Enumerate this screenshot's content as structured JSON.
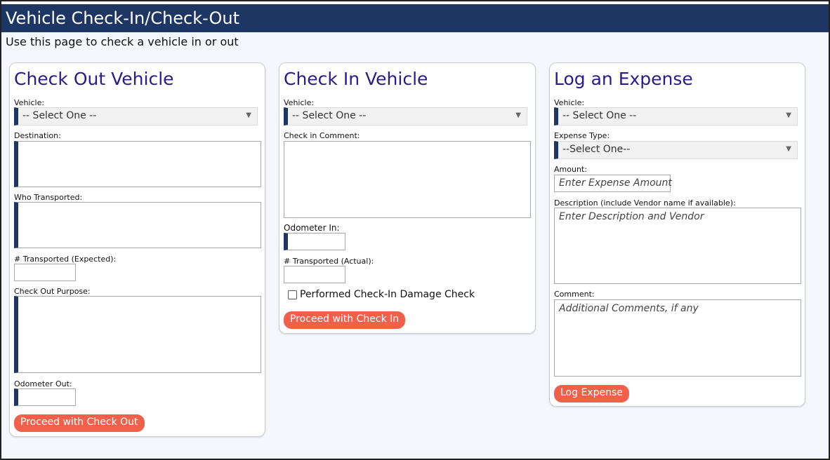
{
  "header": {
    "title": "Vehicle Check-In/Check-Out",
    "subtitle": "Use this page to check a vehicle in or out"
  },
  "checkout": {
    "title": "Check Out Vehicle",
    "vehicle_label": "Vehicle:",
    "vehicle_value": "-- Select One --",
    "destination_label": "Destination:",
    "who_label": "Who Transported:",
    "num_expected_label": "# Transported (Expected):",
    "purpose_label": "Check Out Purpose:",
    "odometer_label": "Odometer Out:",
    "button": "Proceed with Check Out"
  },
  "checkin": {
    "title": "Check In Vehicle",
    "vehicle_label": "Vehicle:",
    "vehicle_value": "-- Select One --",
    "comment_label": "Check in Comment:",
    "odometer_label": "Odometer In:",
    "num_actual_label": "# Transported (Actual):",
    "damage_check_label": "Performed Check-In Damage Check",
    "damage_check_checked": false,
    "button": "Proceed with Check In"
  },
  "expense": {
    "title": "Log an Expense",
    "vehicle_label": "Vehicle:",
    "vehicle_value": "-- Select One --",
    "type_label": "Expense Type:",
    "type_value": "--Select One--",
    "amount_label": "Amount:",
    "amount_placeholder": "Enter Expense Amount",
    "description_label": "Description (include Vendor name if available):",
    "description_placeholder": "Enter Description and Vendor",
    "comment_label": "Comment:",
    "comment_placeholder": "Additional Comments, if any",
    "button": "Log Expense"
  },
  "colors": {
    "header_bg": "#1e3663",
    "card_title": "#2b1a8f",
    "button": "#f0604a",
    "required_marker": "#1e3663"
  }
}
